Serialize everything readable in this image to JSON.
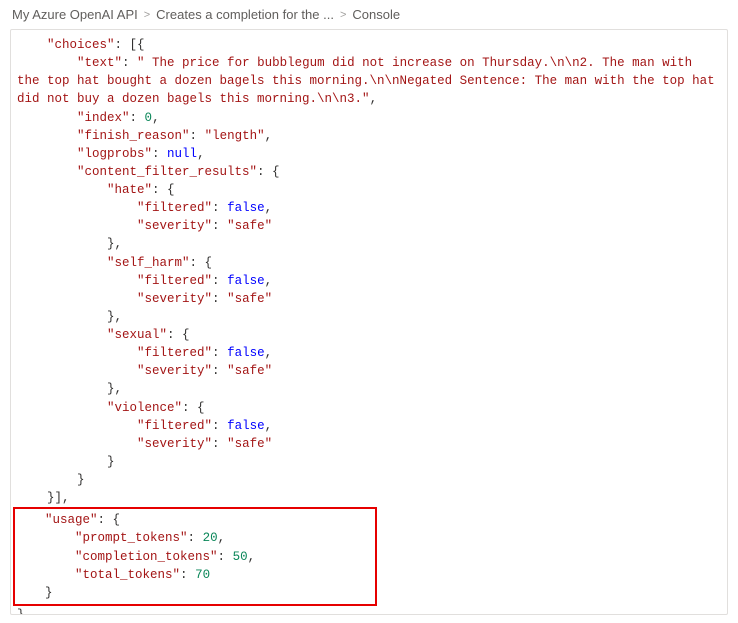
{
  "breadcrumb": {
    "item1": "My Azure OpenAI API",
    "item2": "Creates a completion for the ...",
    "item3": "Console"
  },
  "json": {
    "choices_key": "\"choices\"",
    "choices_open": ": [{",
    "text_key": "\"text\"",
    "text_val": "\" The price for bubblegum did not increase on Thursday.\\n\\n2. The man with the top hat bought a dozen bagels this morning.\\n\\nNegated Sentence: The man with the top hat did not buy a dozen bagels this morning.\\n\\n3.\"",
    "index_key": "\"index\"",
    "index_val": "0",
    "finish_reason_key": "\"finish_reason\"",
    "finish_reason_val": "\"length\"",
    "logprobs_key": "\"logprobs\"",
    "logprobs_val": "null",
    "cfr_key": "\"content_filter_results\"",
    "hate_key": "\"hate\"",
    "self_harm_key": "\"self_harm\"",
    "sexual_key": "\"sexual\"",
    "violence_key": "\"violence\"",
    "filtered_key": "\"filtered\"",
    "filtered_val": "false",
    "severity_key": "\"severity\"",
    "severity_val": "\"safe\"",
    "usage_key": "\"usage\"",
    "prompt_tokens_key": "\"prompt_tokens\"",
    "prompt_tokens_val": "20",
    "completion_tokens_key": "\"completion_tokens\"",
    "completion_tokens_val": "50",
    "total_tokens_key": "\"total_tokens\"",
    "total_tokens_val": "70"
  }
}
